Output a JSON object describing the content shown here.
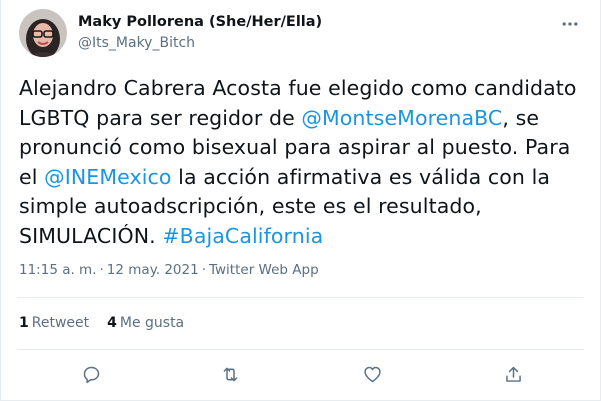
{
  "author": {
    "display_name": "Maky Pollorena (She/Her/Ella)",
    "handle": "@Its_Maky_Bitch"
  },
  "tweet": {
    "segments": [
      {
        "text": "Alejandro Cabrera Acosta fue elegido como candidato LGBTQ para ser regidor de ",
        "type": "text"
      },
      {
        "text": "@MontseMorenaBC",
        "type": "mention"
      },
      {
        "text": ", se pronunció como bisexual para aspirar al puesto. Para el ",
        "type": "text"
      },
      {
        "text": "@INEMexico",
        "type": "mention"
      },
      {
        "text": " la acción afirmativa es válida con la simple autoadscripción, este es el resultado, SIMULACIÓN. ",
        "type": "text"
      },
      {
        "text": "#BajaCalifornia",
        "type": "hashtag"
      }
    ]
  },
  "meta": {
    "time": "11:15 a. m.",
    "separator": "·",
    "date": "12 may. 2021",
    "source": "Twitter Web App"
  },
  "stats": {
    "retweets_count": "1",
    "retweets_label": "Retweet",
    "likes_count": "4",
    "likes_label": "Me gusta"
  },
  "actions": {
    "icons": [
      "reply-icon",
      "retweet-icon",
      "like-icon",
      "share-icon"
    ]
  },
  "colors": {
    "link": "#1b95e0",
    "secondary_text": "#5b7083",
    "primary_text": "#0f1419",
    "divider": "#e6ecf0"
  }
}
